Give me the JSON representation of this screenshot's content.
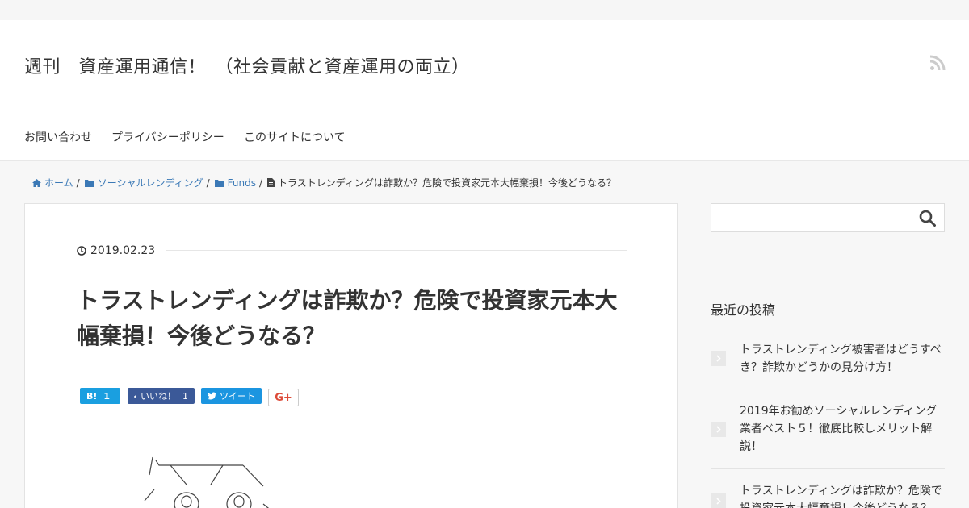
{
  "site": {
    "title": "週刊　資産運用通信！　（社会貢献と資産運用の両立）"
  },
  "header": {
    "rss_icon": "rss-icon"
  },
  "nav": {
    "items": [
      {
        "label": "お問い合わせ"
      },
      {
        "label": "プライバシーポリシー"
      },
      {
        "label": "このサイトについて"
      }
    ]
  },
  "breadcrumb": {
    "home": "ホーム",
    "category1": "ソーシャルレンディング",
    "category2": "Funds",
    "current": "トラストレンディングは詐欺か？危険で投資家元本大幅棄損！今後どうなる？",
    "separator": "/"
  },
  "article": {
    "date": "2019.02.23",
    "title": "トラストレンディングは詐欺か？危険で投資家元本大幅棄損！今後どうなる？"
  },
  "share": {
    "hatena": {
      "label": "B!",
      "count": "1"
    },
    "facebook": {
      "label": "いいね！",
      "count": "1"
    },
    "twitter": {
      "label": "ツイート"
    },
    "googleplus": {
      "label": "G+"
    }
  },
  "sidebar": {
    "search_placeholder": "",
    "recent_title": "最近の投稿",
    "recent_posts": [
      {
        "title": "トラストレンディング被害者はどうすべき？詐欺かどうかの見分け方！"
      },
      {
        "title": "2019年お勧めソーシャルレンディング業者ベスト５！徹底比較しメリット解説！"
      },
      {
        "title": "トラストレンディングは詐欺か？危険で投資家元本大幅棄損！今後どうなる？"
      }
    ]
  },
  "colors": {
    "link": "#3b79b6",
    "hatena": "#1a9fe0",
    "facebook": "#3b5998",
    "twitter": "#1b95e0",
    "googleplus": "#dd4b39"
  }
}
